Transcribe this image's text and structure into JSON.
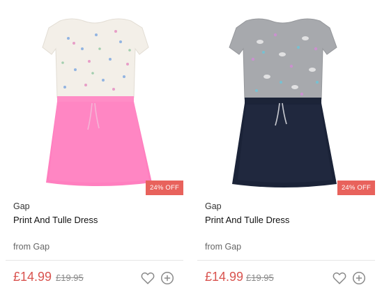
{
  "products": [
    {
      "discount_badge": "24% OFF",
      "brand": "Gap",
      "title": "Print And Tulle Dress",
      "retailer": "from Gap",
      "price": "£14.99",
      "old_price": "£19.95",
      "bodice_color": "#f3efe8",
      "skirt_color": "#ff7fbf",
      "icons": [
        "heart-icon",
        "plus-circle-icon"
      ]
    },
    {
      "discount_badge": "24% OFF",
      "brand": "Gap",
      "title": "Print And Tulle Dress",
      "retailer": "from Gap",
      "price": "£14.99",
      "old_price": "£19.95",
      "bodice_color": "#a7a9ad",
      "skirt_color": "#1b2338",
      "icons": [
        "heart-icon",
        "plus-circle-icon"
      ]
    }
  ],
  "colors": {
    "badge": "#e8625c",
    "price": "#d9534f",
    "old_price": "#8a8a8a"
  }
}
